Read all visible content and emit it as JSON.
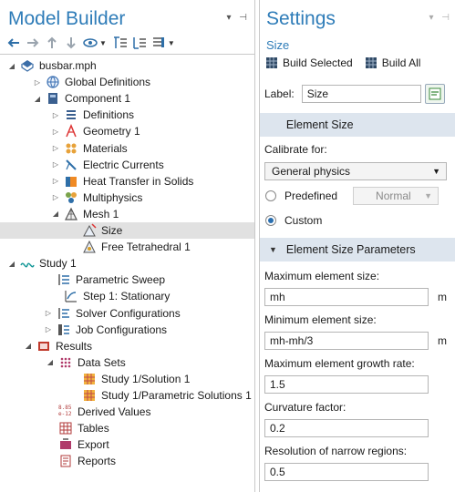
{
  "model_builder": {
    "title": "Model Builder",
    "title_controls": [
      "▾",
      "⊣"
    ],
    "toolbar": [
      "back-arrow",
      "forward-arrow",
      "up-arrow",
      "down-arrow",
      "eye-dropdown",
      "expand-all",
      "collapse-all",
      "list-dropdown"
    ],
    "tree": [
      {
        "label": "busbar.mph",
        "expander": "◢",
        "icon": "model-icon"
      },
      {
        "label": "Global Definitions",
        "expander": "▷",
        "icon": "globe-icon"
      },
      {
        "label": "Component 1",
        "expander": "◢",
        "icon": "component-icon"
      },
      {
        "label": "Definitions",
        "expander": "▷",
        "icon": "definitions-icon"
      },
      {
        "label": "Geometry 1",
        "expander": "▷",
        "icon": "geometry-icon"
      },
      {
        "label": "Materials",
        "expander": "▷",
        "icon": "materials-icon"
      },
      {
        "label": "Electric Currents",
        "expander": "▷",
        "icon": "electric-currents-icon"
      },
      {
        "label": "Heat Transfer in Solids",
        "expander": "▷",
        "icon": "heat-transfer-icon"
      },
      {
        "label": "Multiphysics",
        "expander": "▷",
        "icon": "multiphysics-icon"
      },
      {
        "label": "Mesh 1",
        "expander": "◢",
        "icon": "mesh-icon"
      },
      {
        "label": "Size",
        "expander": "",
        "icon": "size-icon"
      },
      {
        "label": "Free Tetrahedral 1",
        "expander": "",
        "icon": "free-tetrahedral-icon"
      },
      {
        "label": "Study 1",
        "expander": "◢",
        "icon": "study-icon"
      },
      {
        "label": "Parametric Sweep",
        "expander": "",
        "icon": "parametric-sweep-icon"
      },
      {
        "label": "Step 1: Stationary",
        "expander": "",
        "icon": "stationary-step-icon"
      },
      {
        "label": "Solver Configurations",
        "expander": "▷",
        "icon": "solver-icon"
      },
      {
        "label": "Job Configurations",
        "expander": "▷",
        "icon": "job-icon"
      },
      {
        "label": "Results",
        "expander": "◢",
        "icon": "results-icon"
      },
      {
        "label": "Data Sets",
        "expander": "◢",
        "icon": "datasets-icon"
      },
      {
        "label": "Study 1/Solution 1",
        "expander": "",
        "icon": "solution-icon"
      },
      {
        "label": "Study 1/Parametric Solutions 1",
        "expander": "",
        "icon": "parametric-solutions-icon"
      },
      {
        "label": "Derived Values",
        "expander": "",
        "icon": "derived-values-icon"
      },
      {
        "label": "Tables",
        "expander": "",
        "icon": "tables-icon"
      },
      {
        "label": "Export",
        "expander": "",
        "icon": "export-icon"
      },
      {
        "label": "Reports",
        "expander": "",
        "icon": "reports-icon"
      }
    ],
    "derived_values_glyph": "8.85\ne-12"
  },
  "settings": {
    "title": "Settings",
    "title_controls": [
      "▾",
      "⊣"
    ],
    "subtitle": "Size",
    "build_selected": "Build Selected",
    "build_all": "Build All",
    "label_caption": "Label:",
    "label_value": "Size",
    "section_element_size": "Element Size",
    "calibrate_caption": "Calibrate for:",
    "calibrate_value": "General physics",
    "predefined_label": "Predefined",
    "predefined_value": "Normal",
    "custom_label": "Custom",
    "section_params": "Element Size Parameters",
    "params": [
      {
        "label": "Maximum element size:",
        "value": "mh",
        "unit": "m"
      },
      {
        "label": "Minimum element size:",
        "value": "mh-mh/3",
        "unit": "m"
      },
      {
        "label": "Maximum element growth rate:",
        "value": "1.5",
        "unit": ""
      },
      {
        "label": "Curvature factor:",
        "value": "0.2",
        "unit": ""
      },
      {
        "label": "Resolution of narrow regions:",
        "value": "0.5",
        "unit": ""
      }
    ]
  },
  "colors": {
    "accent": "#2e7cb8",
    "section_bg": "#dde5ee",
    "selected_row": "#e1e1e1"
  }
}
